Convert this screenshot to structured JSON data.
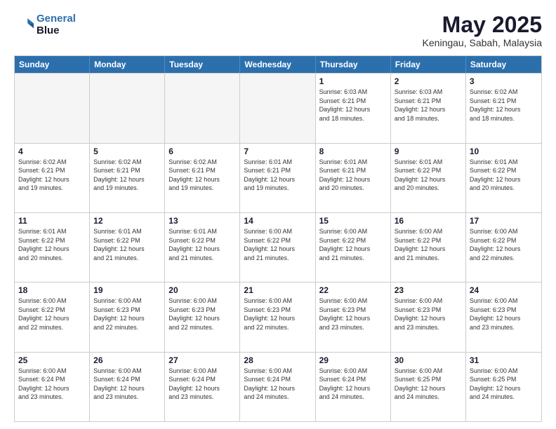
{
  "logo": {
    "line1": "General",
    "line2": "Blue"
  },
  "title": "May 2025",
  "location": "Keningau, Sabah, Malaysia",
  "header_days": [
    "Sunday",
    "Monday",
    "Tuesday",
    "Wednesday",
    "Thursday",
    "Friday",
    "Saturday"
  ],
  "weeks": [
    [
      {
        "day": "",
        "info": ""
      },
      {
        "day": "",
        "info": ""
      },
      {
        "day": "",
        "info": ""
      },
      {
        "day": "",
        "info": ""
      },
      {
        "day": "1",
        "info": "Sunrise: 6:03 AM\nSunset: 6:21 PM\nDaylight: 12 hours\nand 18 minutes."
      },
      {
        "day": "2",
        "info": "Sunrise: 6:03 AM\nSunset: 6:21 PM\nDaylight: 12 hours\nand 18 minutes."
      },
      {
        "day": "3",
        "info": "Sunrise: 6:02 AM\nSunset: 6:21 PM\nDaylight: 12 hours\nand 18 minutes."
      }
    ],
    [
      {
        "day": "4",
        "info": "Sunrise: 6:02 AM\nSunset: 6:21 PM\nDaylight: 12 hours\nand 19 minutes."
      },
      {
        "day": "5",
        "info": "Sunrise: 6:02 AM\nSunset: 6:21 PM\nDaylight: 12 hours\nand 19 minutes."
      },
      {
        "day": "6",
        "info": "Sunrise: 6:02 AM\nSunset: 6:21 PM\nDaylight: 12 hours\nand 19 minutes."
      },
      {
        "day": "7",
        "info": "Sunrise: 6:01 AM\nSunset: 6:21 PM\nDaylight: 12 hours\nand 19 minutes."
      },
      {
        "day": "8",
        "info": "Sunrise: 6:01 AM\nSunset: 6:21 PM\nDaylight: 12 hours\nand 20 minutes."
      },
      {
        "day": "9",
        "info": "Sunrise: 6:01 AM\nSunset: 6:22 PM\nDaylight: 12 hours\nand 20 minutes."
      },
      {
        "day": "10",
        "info": "Sunrise: 6:01 AM\nSunset: 6:22 PM\nDaylight: 12 hours\nand 20 minutes."
      }
    ],
    [
      {
        "day": "11",
        "info": "Sunrise: 6:01 AM\nSunset: 6:22 PM\nDaylight: 12 hours\nand 20 minutes."
      },
      {
        "day": "12",
        "info": "Sunrise: 6:01 AM\nSunset: 6:22 PM\nDaylight: 12 hours\nand 21 minutes."
      },
      {
        "day": "13",
        "info": "Sunrise: 6:01 AM\nSunset: 6:22 PM\nDaylight: 12 hours\nand 21 minutes."
      },
      {
        "day": "14",
        "info": "Sunrise: 6:00 AM\nSunset: 6:22 PM\nDaylight: 12 hours\nand 21 minutes."
      },
      {
        "day": "15",
        "info": "Sunrise: 6:00 AM\nSunset: 6:22 PM\nDaylight: 12 hours\nand 21 minutes."
      },
      {
        "day": "16",
        "info": "Sunrise: 6:00 AM\nSunset: 6:22 PM\nDaylight: 12 hours\nand 21 minutes."
      },
      {
        "day": "17",
        "info": "Sunrise: 6:00 AM\nSunset: 6:22 PM\nDaylight: 12 hours\nand 22 minutes."
      }
    ],
    [
      {
        "day": "18",
        "info": "Sunrise: 6:00 AM\nSunset: 6:22 PM\nDaylight: 12 hours\nand 22 minutes."
      },
      {
        "day": "19",
        "info": "Sunrise: 6:00 AM\nSunset: 6:23 PM\nDaylight: 12 hours\nand 22 minutes."
      },
      {
        "day": "20",
        "info": "Sunrise: 6:00 AM\nSunset: 6:23 PM\nDaylight: 12 hours\nand 22 minutes."
      },
      {
        "day": "21",
        "info": "Sunrise: 6:00 AM\nSunset: 6:23 PM\nDaylight: 12 hours\nand 22 minutes."
      },
      {
        "day": "22",
        "info": "Sunrise: 6:00 AM\nSunset: 6:23 PM\nDaylight: 12 hours\nand 23 minutes."
      },
      {
        "day": "23",
        "info": "Sunrise: 6:00 AM\nSunset: 6:23 PM\nDaylight: 12 hours\nand 23 minutes."
      },
      {
        "day": "24",
        "info": "Sunrise: 6:00 AM\nSunset: 6:23 PM\nDaylight: 12 hours\nand 23 minutes."
      }
    ],
    [
      {
        "day": "25",
        "info": "Sunrise: 6:00 AM\nSunset: 6:24 PM\nDaylight: 12 hours\nand 23 minutes."
      },
      {
        "day": "26",
        "info": "Sunrise: 6:00 AM\nSunset: 6:24 PM\nDaylight: 12 hours\nand 23 minutes."
      },
      {
        "day": "27",
        "info": "Sunrise: 6:00 AM\nSunset: 6:24 PM\nDaylight: 12 hours\nand 23 minutes."
      },
      {
        "day": "28",
        "info": "Sunrise: 6:00 AM\nSunset: 6:24 PM\nDaylight: 12 hours\nand 24 minutes."
      },
      {
        "day": "29",
        "info": "Sunrise: 6:00 AM\nSunset: 6:24 PM\nDaylight: 12 hours\nand 24 minutes."
      },
      {
        "day": "30",
        "info": "Sunrise: 6:00 AM\nSunset: 6:25 PM\nDaylight: 12 hours\nand 24 minutes."
      },
      {
        "day": "31",
        "info": "Sunrise: 6:00 AM\nSunset: 6:25 PM\nDaylight: 12 hours\nand 24 minutes."
      }
    ]
  ]
}
